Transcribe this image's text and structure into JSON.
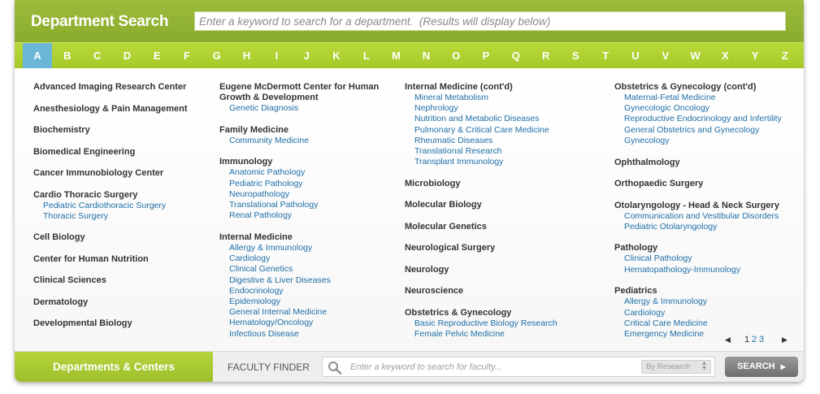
{
  "header": {
    "title": "Department Search",
    "search_placeholder": "Enter a keyword to search for a department.  (Results will display below)"
  },
  "alphabet": [
    "A",
    "B",
    "C",
    "D",
    "E",
    "F",
    "G",
    "H",
    "I",
    "J",
    "K",
    "L",
    "M",
    "N",
    "O",
    "P",
    "Q",
    "R",
    "S",
    "T",
    "U",
    "V",
    "W",
    "X",
    "Y",
    "Z"
  ],
  "active_letter": "A",
  "columns": [
    [
      {
        "name": "Advanced Imaging Research Center",
        "subs": []
      },
      {
        "name": "Anesthesiology & Pain Management",
        "subs": []
      },
      {
        "name": "Biochemistry",
        "subs": []
      },
      {
        "name": "Biomedical Engineering",
        "subs": []
      },
      {
        "name": "Cancer Immunobiology Center",
        "subs": []
      },
      {
        "name": "Cardio Thoracic Surgery",
        "subs": [
          "Pediatric Cardiothoracic Surgery",
          "Thoracic Surgery"
        ]
      },
      {
        "name": "Cell Biology",
        "subs": []
      },
      {
        "name": "Center for Human Nutrition",
        "subs": []
      },
      {
        "name": "Clinical Sciences",
        "subs": []
      },
      {
        "name": "Dermatology",
        "subs": []
      },
      {
        "name": "Developmental Biology",
        "subs": []
      }
    ],
    [
      {
        "name": "Eugene McDermott Center for Human Growth & Development",
        "subs": [
          "Genetic Diagnosis"
        ]
      },
      {
        "name": "Family Medicine",
        "subs": [
          "Community Medicine"
        ]
      },
      {
        "name": "Immunology",
        "subs": [
          "Anatomic Pathology",
          "Pediatric Pathology",
          "Neuropathology",
          "Translational Pathology",
          "Renal Pathology"
        ]
      },
      {
        "name": "Internal Medicine",
        "subs": [
          "Allergy & Immunology",
          "Cardiology",
          "Clinical Genetics",
          "Digestive & Liver Diseases",
          "Endocrinology",
          "Epidemiology",
          "General Internal Medicine",
          "Hematology/Oncology",
          "Infectious Disease"
        ]
      }
    ],
    [
      {
        "name": "Internal Medicine (cont'd)",
        "subs": [
          "Mineral Metabolism",
          "Nephrology",
          "Nutrition and Metabolic Diseases",
          "Pulmonary & Critical Care Medicine",
          "Rheumatic Diseases",
          "Translational Research",
          "Transplant Immunology"
        ]
      },
      {
        "name": "Microbiology",
        "subs": []
      },
      {
        "name": "Molecular Biology",
        "subs": []
      },
      {
        "name": "Molecular Genetics",
        "subs": []
      },
      {
        "name": "Neurological Surgery",
        "subs": []
      },
      {
        "name": "Neurology",
        "subs": []
      },
      {
        "name": "Neuroscience",
        "subs": []
      },
      {
        "name": "Obstetrics & Gynecology",
        "subs": [
          "Basic Reproductive Biology Research",
          "Female Pelvic Medicine"
        ]
      }
    ],
    [
      {
        "name": "Obstetrics & Gynecology  (cont'd)",
        "subs": [
          "Maternal-Fetal Medicine",
          "Gynecologic Oncology",
          "Reproductive Endocrinology and Infertility",
          "General Obstetrics and Gynecology",
          "Gynecology"
        ]
      },
      {
        "name": "Ophthalmology",
        "subs": []
      },
      {
        "name": "Orthopaedic Surgery",
        "subs": []
      },
      {
        "name": "Otolaryngology - Head & Neck Surgery",
        "subs": [
          "Communication and Vestibular Disorders",
          "Pediatric Otolaryngology"
        ]
      },
      {
        "name": "Pathology",
        "subs": [
          "Clinical Pathology",
          "Hematopathology-Immunology"
        ]
      },
      {
        "name": "Pediatrics",
        "subs": [
          "Allergy & Immunology",
          "Cardiology",
          "Critical Care Medicine",
          "Emergency Medicine"
        ]
      }
    ]
  ],
  "pagination": {
    "pages": [
      "1",
      "2",
      "3"
    ],
    "current": "1",
    "prev_icon": "triangle-left-icon",
    "next_icon": "triangle-right-icon"
  },
  "bottom": {
    "tab_label": "Departments & Centers",
    "faculty_label": "FACULTY FINDER",
    "faculty_placeholder": "Enter a keyword to search for faculty...",
    "select_value": "By Research",
    "search_button": "SEARCH",
    "search_icon": "magnifier-icon"
  },
  "colors": {
    "green": "#9dbf2a",
    "active_letter": "#6ab6d6",
    "link": "#1f6ea8"
  }
}
